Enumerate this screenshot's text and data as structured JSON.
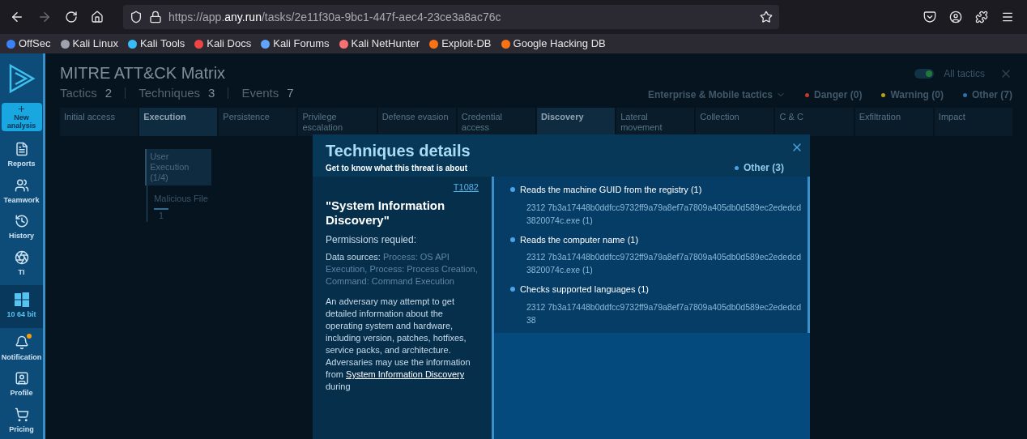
{
  "browser": {
    "forward_disabled": true,
    "url": {
      "before": "https://app.",
      "domain": "any.run",
      "after": "/tasks/2e11f30a-9bc1-447f-aec4-23ce3a8ac76c"
    },
    "bookmarks": [
      {
        "label": "OffSec",
        "color": "#3b82f6"
      },
      {
        "label": "Kali Linux",
        "color": "#9ca3af"
      },
      {
        "label": "Kali Tools",
        "color": "#38bdf8"
      },
      {
        "label": "Kali Docs",
        "color": "#ef4444"
      },
      {
        "label": "Kali Forums",
        "color": "#60a5fa"
      },
      {
        "label": "Kali NetHunter",
        "color": "#f87171"
      },
      {
        "label": "Exploit-DB",
        "color": "#f97316"
      },
      {
        "label": "Google Hacking DB",
        "color": "#f97316"
      }
    ]
  },
  "sidebar": {
    "new_analysis": "New analysis",
    "items": [
      {
        "kind": "reports",
        "label": "Reports",
        "selected": false
      },
      {
        "kind": "teamwork",
        "label": "Teamwork",
        "selected": false
      },
      {
        "kind": "history",
        "label": "History",
        "selected": false
      },
      {
        "kind": "ti",
        "label": "TI",
        "selected": false
      },
      {
        "kind": "os",
        "label": "10 64 bit",
        "selected": true
      },
      {
        "kind": "notifications",
        "label": "Notification",
        "selected": false,
        "badge": true
      },
      {
        "kind": "profile",
        "label": "Profile",
        "selected": false
      },
      {
        "kind": "pricing",
        "label": "Pricing",
        "selected": false
      }
    ]
  },
  "matrix": {
    "title": "MITRE ATT&CK Matrix",
    "stats": [
      {
        "label": "Tactics",
        "value": "2"
      },
      {
        "label": "Techniques",
        "value": "3"
      },
      {
        "label": "Events",
        "value": "7"
      }
    ],
    "all_tactics": {
      "label": "All tactics",
      "on": true
    },
    "filter": "Enterprise & Mobile tactics",
    "legend": [
      {
        "label": "Danger (**0**)",
        "color": "#c0392b"
      },
      {
        "label": "Warning (**0**)",
        "color": "#b8a21a"
      },
      {
        "label": "Other (**7**)",
        "color": "#2f6fa8"
      }
    ],
    "tactics": [
      {
        "label": "Initial access",
        "active": false
      },
      {
        "label": "Execution",
        "active": true,
        "techniques": [
          {
            "label": "User Execution (1/4)",
            "children": [
              {
                "label": "Malicious File",
                "count": "1"
              }
            ]
          }
        ]
      },
      {
        "label": "Persistence",
        "active": false
      },
      {
        "label": "Privilege escalation",
        "active": false
      },
      {
        "label": "Defense evasion",
        "active": false
      },
      {
        "label": "Credential access",
        "active": false
      },
      {
        "label": "Discovery",
        "active": true
      },
      {
        "label": "Lateral movement",
        "active": false
      },
      {
        "label": "Collection",
        "active": false
      },
      {
        "label": "C & C",
        "active": false
      },
      {
        "label": "Exfiltration",
        "active": false
      },
      {
        "label": "Impact",
        "active": false
      }
    ]
  },
  "details": {
    "title": "Techniques details",
    "subtitle": "Get to know what this threat is about",
    "badge": {
      "label": "Other (**3**)",
      "color": "#4aa3e6"
    },
    "id": "T1082",
    "name": "\"System Information Discovery\"",
    "permissions": "Permissions requied:",
    "data_sources_label": "Data sources:",
    "data_sources": "Process: OS API Execution, Process: Process Creation, Command: Command Execution",
    "description": {
      "before": "An adversary may attempt to get detailed information about the operating system and hardware, including version, patches, hotfixes, service packs, and architecture. Adversaries may use the information from",
      "link": "System Information Discovery",
      "after": "during"
    },
    "events": [
      {
        "title": "Reads the machine GUID from the registry (1)",
        "process": "2312 7b3a17448b0ddfcc9732ff9a79a8ef7a7809a405db0d589ec2ededcd3820074c.exe (1)"
      },
      {
        "title": "Reads the computer name (1)",
        "process": "2312 7b3a17448b0ddfcc9732ff9a79a8ef7a7809a405db0d589ec2ededcd3820074c.exe (1)"
      },
      {
        "title": "Checks supported languages (1)",
        "process": "2312 7b3a17448b0ddfcc9732ff9a79a8ef7a7809a405db0d589ec2ededcd38"
      }
    ]
  }
}
